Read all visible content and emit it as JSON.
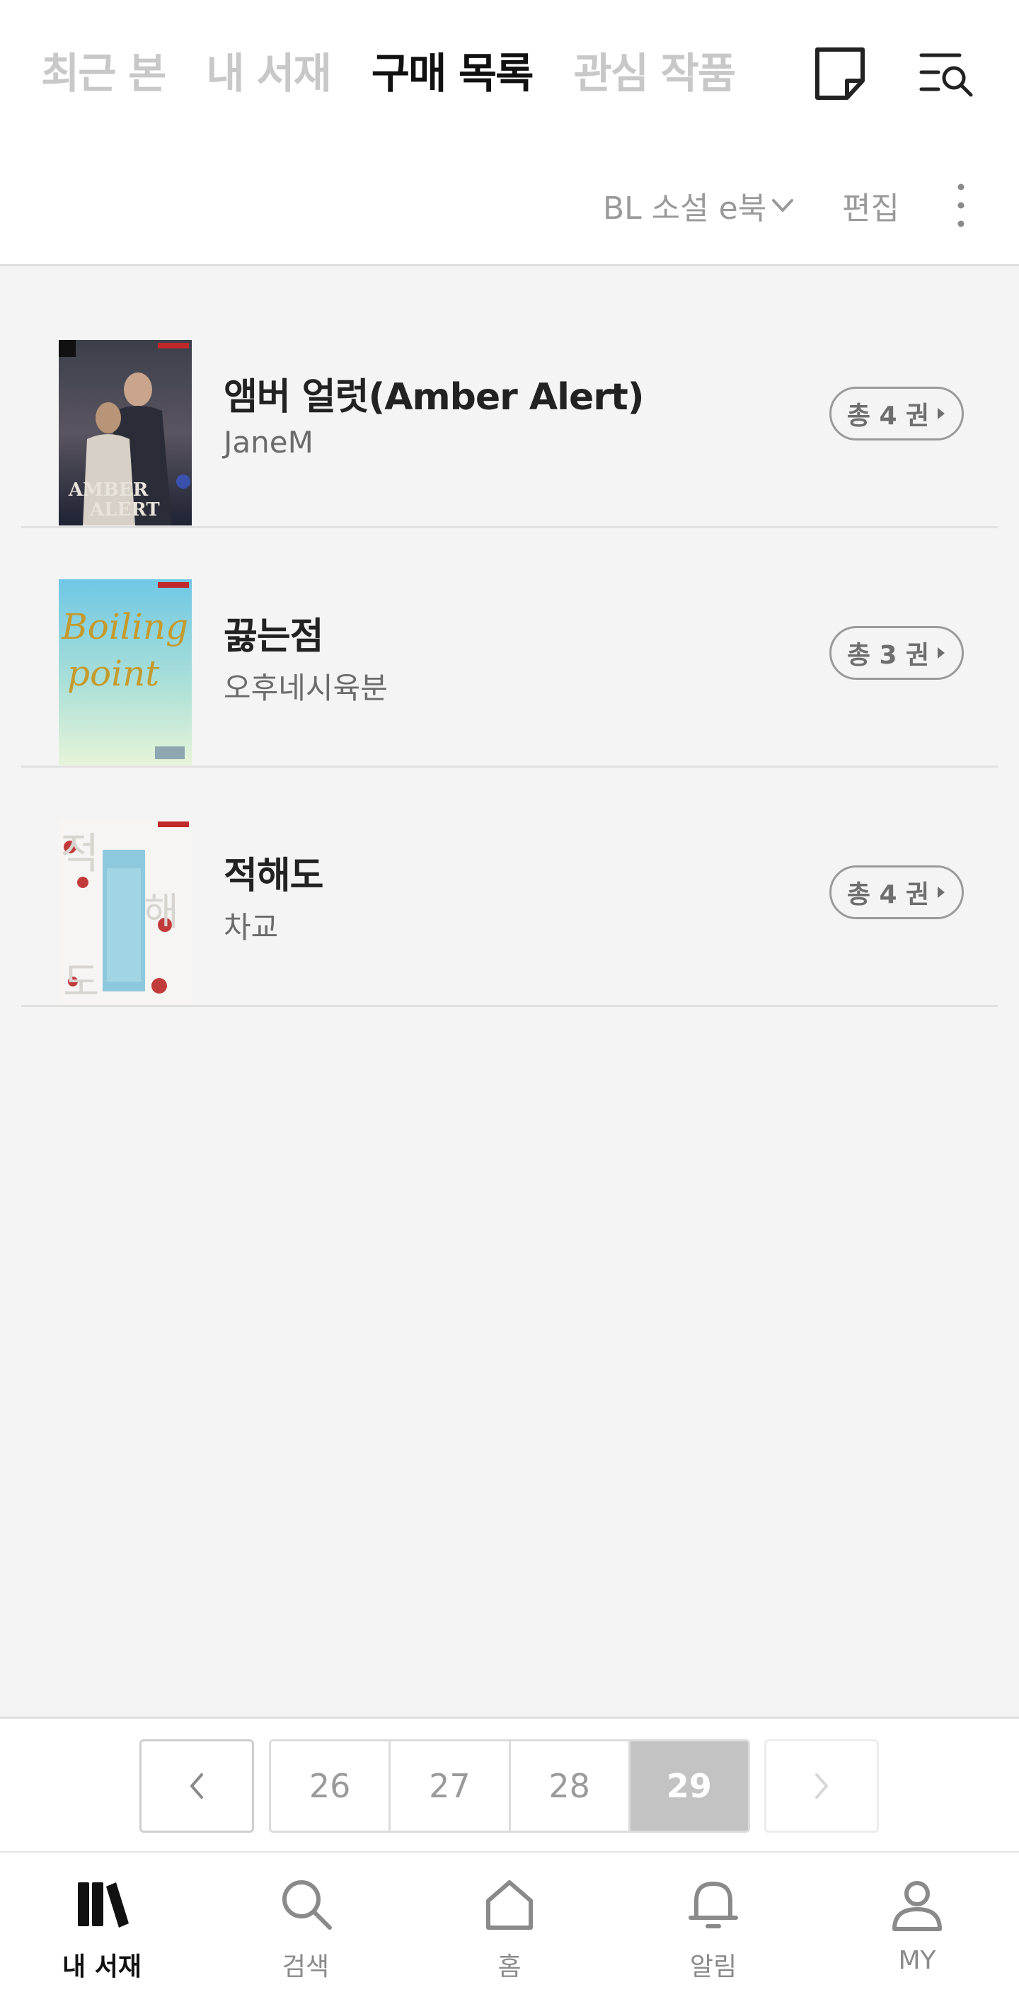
{
  "header": {
    "tabs": [
      {
        "label": "최근 본",
        "active": false
      },
      {
        "label": "내 서재",
        "active": false
      },
      {
        "label": "구매 목록",
        "active": true
      },
      {
        "label": "관심 작품",
        "active": false
      }
    ],
    "icons": [
      "memo-icon",
      "list-search-icon"
    ]
  },
  "toolbar": {
    "filter_label": "BL 소설 e북",
    "edit_label": "편집",
    "more_icon": "more-vertical-icon"
  },
  "books": [
    {
      "title": "앰버 얼럿(Amber Alert)",
      "author": "JaneM",
      "count": "총 4 권",
      "cover_text": "AMBER ALERT"
    },
    {
      "title": "끓는점",
      "author": "오후네시육분",
      "count": "총 3 권",
      "cover_text": "Boiling point"
    },
    {
      "title": "적해도",
      "author": "차교",
      "count": "총 4 권",
      "cover_text": "적해도"
    }
  ],
  "pagination": {
    "pages": [
      "26",
      "27",
      "28",
      "29"
    ],
    "current": "29",
    "prev_icon": "chevron-left-icon",
    "next_icon": "chevron-right-icon"
  },
  "bottom_nav": [
    {
      "label": "내 서재",
      "icon": "library-icon",
      "active": true
    },
    {
      "label": "검색",
      "icon": "search-icon",
      "active": false
    },
    {
      "label": "홈",
      "icon": "home-icon",
      "active": false
    },
    {
      "label": "알림",
      "icon": "bell-icon",
      "active": false
    },
    {
      "label": "MY",
      "icon": "user-icon",
      "active": false
    }
  ],
  "colors": {
    "background": "#f4f4f5",
    "active_text": "#111111",
    "inactive_tab": "#c8c8c8",
    "muted": "#9a9a9a",
    "current_page": "#c3c3c3"
  }
}
